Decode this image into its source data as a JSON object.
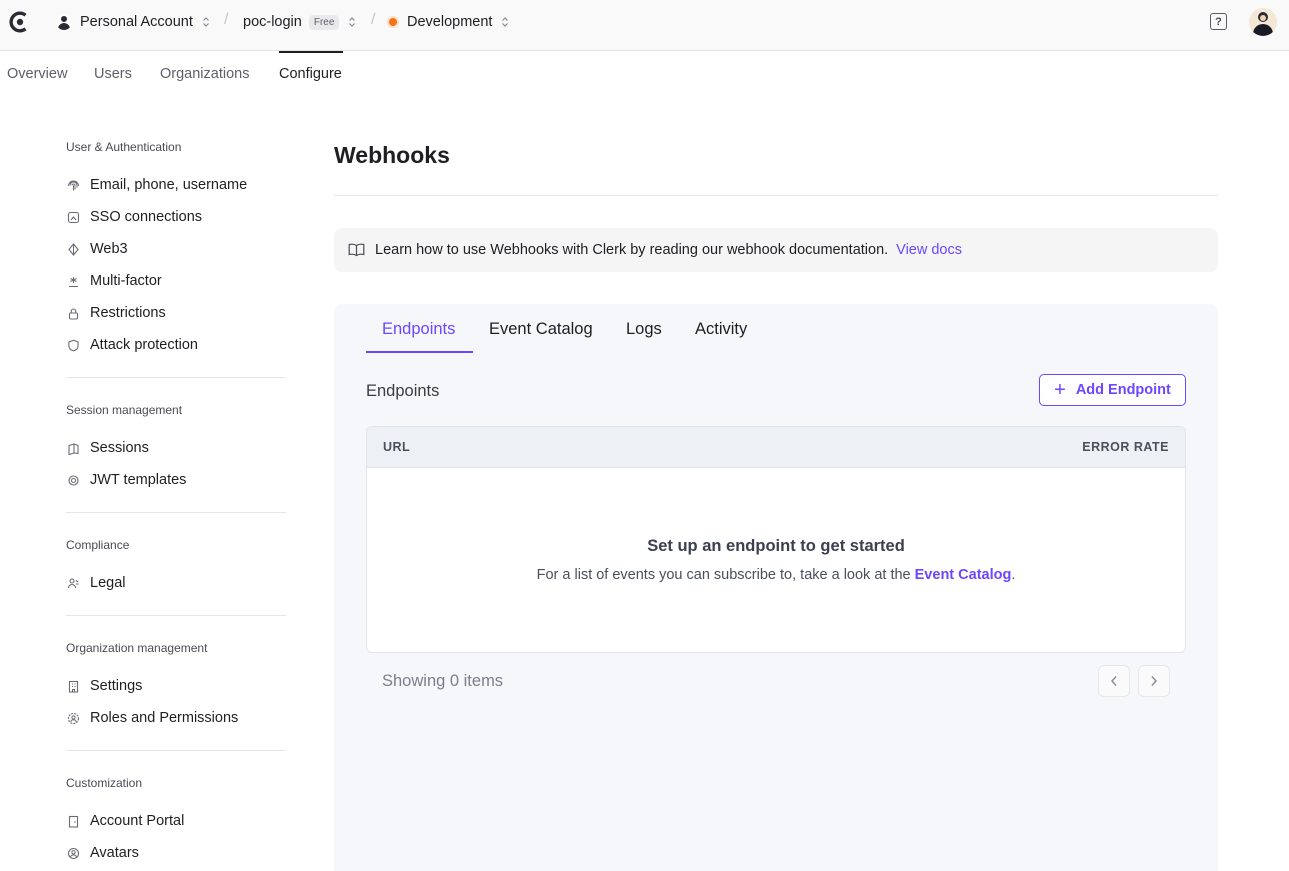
{
  "topbar": {
    "account": "Personal Account",
    "app": "poc-login",
    "plan_badge": "Free",
    "environment": "Development",
    "env_color": "#f97316",
    "help_icon": "?"
  },
  "nav": {
    "items": [
      "Overview",
      "Users",
      "Organizations",
      "Configure"
    ],
    "active": "Configure"
  },
  "sidebar": {
    "sections": [
      {
        "title": "User & Authentication",
        "items": [
          {
            "label": "Email, phone, username",
            "icon": "fingerprint-icon"
          },
          {
            "label": "SSO connections",
            "icon": "sso-icon"
          },
          {
            "label": "Web3",
            "icon": "web3-icon"
          },
          {
            "label": "Multi-factor",
            "icon": "asterisk-icon"
          },
          {
            "label": "Restrictions",
            "icon": "lock-icon"
          },
          {
            "label": "Attack protection",
            "icon": "shield-icon"
          }
        ]
      },
      {
        "title": "Session management",
        "items": [
          {
            "label": "Sessions",
            "icon": "sessions-icon"
          },
          {
            "label": "JWT templates",
            "icon": "jwt-icon"
          }
        ]
      },
      {
        "title": "Compliance",
        "items": [
          {
            "label": "Legal",
            "icon": "legal-icon"
          }
        ]
      },
      {
        "title": "Organization management",
        "items": [
          {
            "label": "Settings",
            "icon": "building-icon"
          },
          {
            "label": "Roles and Permissions",
            "icon": "roles-icon"
          }
        ]
      },
      {
        "title": "Customization",
        "items": [
          {
            "label": "Account Portal",
            "icon": "portal-icon"
          },
          {
            "label": "Avatars",
            "icon": "avatar-icon"
          }
        ]
      }
    ]
  },
  "main": {
    "title": "Webhooks",
    "info_text": "Learn how to use Webhooks with Clerk by reading our webhook documentation.",
    "info_link": "View docs",
    "tabs": [
      "Endpoints",
      "Event Catalog",
      "Logs",
      "Activity"
    ],
    "active_tab": "Endpoints",
    "section_label": "Endpoints",
    "add_button": "Add Endpoint",
    "table": {
      "col_url": "URL",
      "col_error_rate": "ERROR RATE",
      "empty_title": "Set up an endpoint to get started",
      "empty_sub_prefix": "For a list of events you can subscribe to, take a look at the",
      "empty_sub_link": "Event Catalog",
      "empty_sub_suffix": "."
    },
    "showing": "Showing 0 items"
  },
  "colors": {
    "accent": "#6c47ff"
  }
}
